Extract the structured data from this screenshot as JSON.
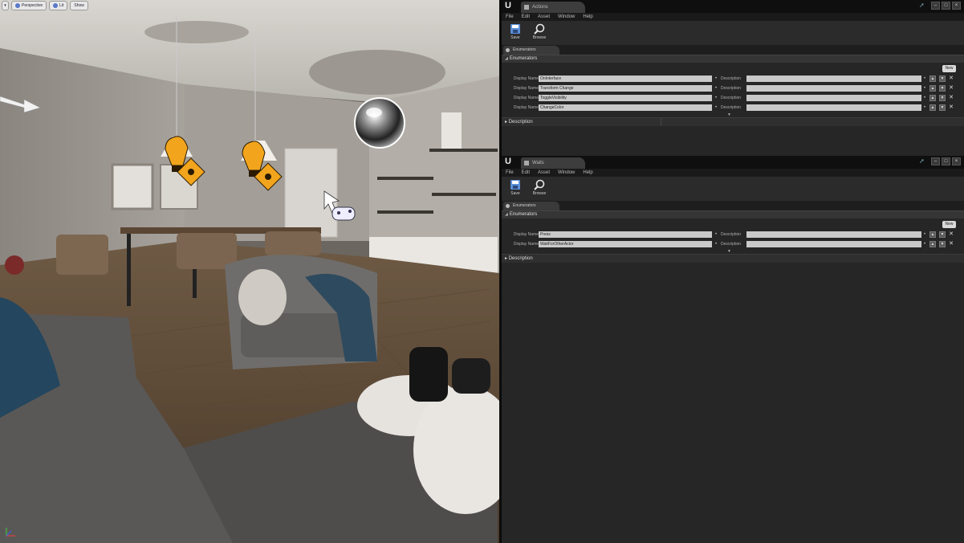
{
  "viewport": {
    "toolbar": {
      "perspective_label": "Perspective",
      "lit_label": "Lit",
      "show_label": "Show"
    }
  },
  "editors": [
    {
      "tab_title": "Actions",
      "menu": [
        "File",
        "Edit",
        "Asset",
        "Window",
        "Help"
      ],
      "toolbar": {
        "save_label": "Save",
        "browse_label": "Browse"
      },
      "panel_tab": "Enumerators",
      "section_title": "Enumerators",
      "new_label": "New",
      "display_name_label": "Display Name",
      "description_label": "Description",
      "enumerators": [
        "OnInterface",
        "Transform Change",
        "ToggleVisibility",
        "ChangeColor"
      ],
      "description_section": "Description"
    },
    {
      "tab_title": "Waits",
      "menu": [
        "File",
        "Edit",
        "Asset",
        "Window",
        "Help"
      ],
      "toolbar": {
        "save_label": "Save",
        "browse_label": "Browse"
      },
      "panel_tab": "Enumerators",
      "section_title": "Enumerators",
      "new_label": "New",
      "display_name_label": "Display Name",
      "description_label": "Description",
      "enumerators": [
        "Press",
        "WaitForOtherActor"
      ],
      "description_section": "Description"
    }
  ]
}
